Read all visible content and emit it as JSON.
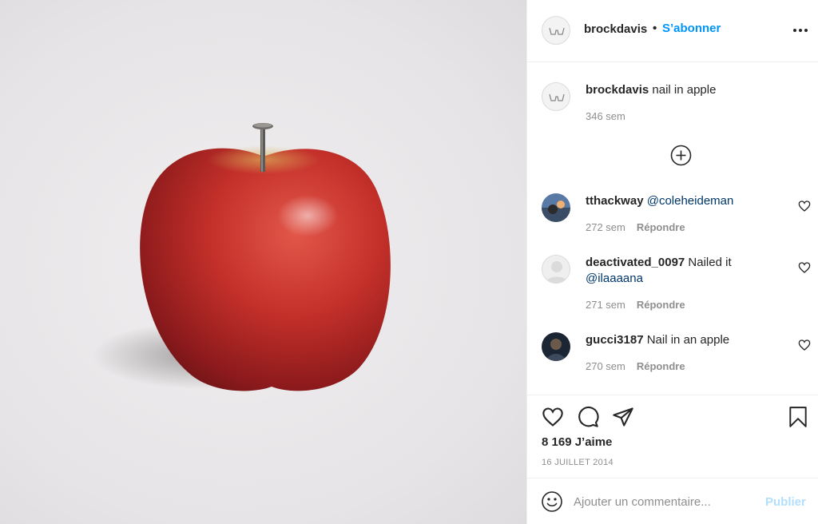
{
  "post": {
    "author": "brockdavis",
    "follow_label": "S’abonner",
    "separator": "•"
  },
  "caption": {
    "username": "brockdavis",
    "text": "nail in apple",
    "time": "346 sem"
  },
  "comments": [
    {
      "username": "tthackway",
      "text": "@coleheideman",
      "time": "272 sem",
      "reply": "Répondre"
    },
    {
      "username": "deactivated_0097",
      "text": "Nailed it",
      "mention": "@ilaaaana",
      "time": "271 sem",
      "reply": "Répondre"
    },
    {
      "username": "gucci3187",
      "text": "Nail in an apple",
      "time": "270 sem",
      "reply": "Répondre"
    }
  ],
  "stats": {
    "likes": "8 169 J’aime",
    "date": "16 JUILLET 2014"
  },
  "composer": {
    "placeholder": "Ajouter un commentaire...",
    "publish_label": "Publier"
  },
  "icons": [
    "more-icon",
    "add-circle-icon",
    "heart-icon",
    "comment-icon",
    "share-icon",
    "bookmark-icon",
    "emoji-icon"
  ],
  "colors": {
    "link": "#0095f6",
    "mention": "#00376b",
    "muted": "#8e8e8e",
    "publish_disabled": "#b2dffc"
  }
}
